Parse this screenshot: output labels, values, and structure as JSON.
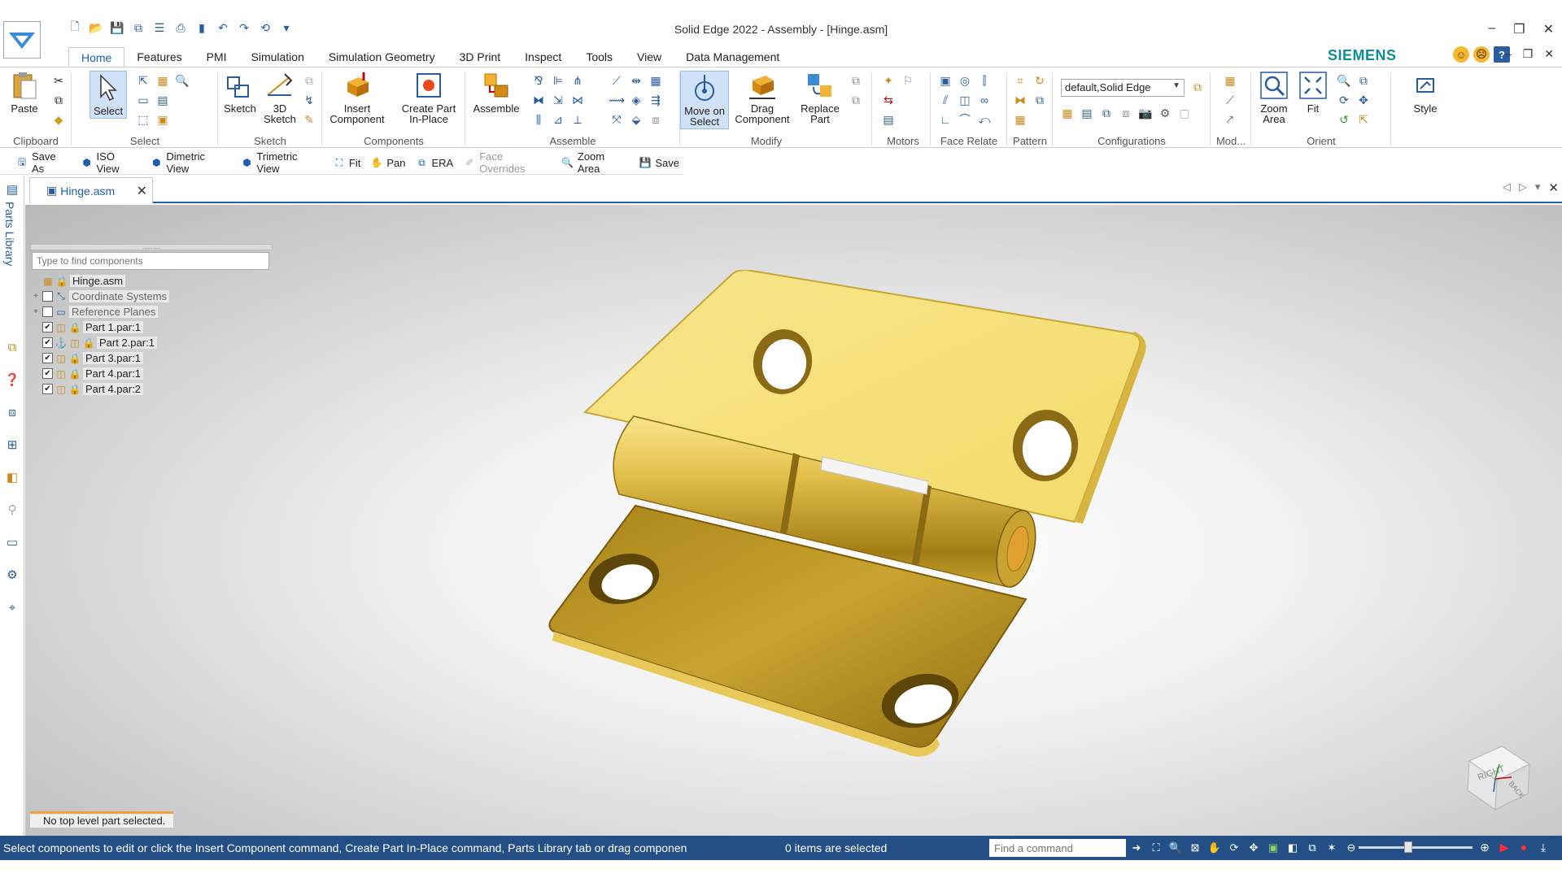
{
  "window": {
    "title": "Solid Edge 2022 - Assembly - [Hinge.asm]",
    "brand": "SIEMENS",
    "brand_color": "#0f8c9a"
  },
  "ribbon_tabs": [
    "Home",
    "Features",
    "PMI",
    "Simulation",
    "Simulation Geometry",
    "3D Print",
    "Inspect",
    "Tools",
    "View",
    "Data Management"
  ],
  "ribbon": {
    "groups": {
      "clipboard": "Clipboard",
      "select": "Select",
      "sketch": "Sketch",
      "components": "Components",
      "assemble": "Assemble",
      "modify": "Modify",
      "motors": "Motors",
      "face_relate": "Face Relate",
      "pattern": "Pattern",
      "configurations": "Configurations",
      "mod": "Mod...",
      "orient": "Orient"
    },
    "buttons": {
      "paste": "Paste",
      "select": "Select",
      "sketch": "Sketch",
      "sketch3d": "3D Sketch",
      "insert_component": "Insert Component",
      "create_part_inplace": "Create Part In-Place",
      "assemble": "Assemble",
      "move_on_select": "Move on Select",
      "drag_component": "Drag Component",
      "replace_part": "Replace Part",
      "zoom_area": "Zoom Area",
      "fit": "Fit",
      "style": "Style"
    },
    "configuration_value": "default,Solid Edge"
  },
  "command_bar": [
    {
      "label": "Save As",
      "icon": "save-as-icon",
      "enabled": true
    },
    {
      "label": "ISO View",
      "icon": "iso-view-icon",
      "enabled": true
    },
    {
      "label": "Dimetric View",
      "icon": "dimetric-view-icon",
      "enabled": true
    },
    {
      "label": "Trimetric View",
      "icon": "trimetric-view-icon",
      "enabled": true
    },
    {
      "label": "Fit",
      "icon": "fit-icon",
      "enabled": true
    },
    {
      "label": "Pan",
      "icon": "pan-icon",
      "enabled": true
    },
    {
      "label": "ERA",
      "icon": "era-icon",
      "enabled": true
    },
    {
      "label": "Face Overrides",
      "icon": "face-overrides-icon",
      "enabled": false
    },
    {
      "label": "Zoom Area",
      "icon": "zoom-area-icon",
      "enabled": true
    },
    {
      "label": "Save",
      "icon": "save-icon",
      "enabled": true
    }
  ],
  "doc_tab": {
    "label": "Hinge.asm"
  },
  "left_strip": {
    "label": "Parts Library"
  },
  "pathfinder": {
    "search_placeholder": "Type to find components",
    "handle": "..........",
    "items": [
      {
        "label": "Hinge.asm",
        "checked": null,
        "expander": ""
      },
      {
        "label": "Coordinate Systems",
        "checked": false,
        "expander": "+"
      },
      {
        "label": "Reference Planes",
        "checked": false,
        "expander": "+"
      },
      {
        "label": "Part 1.par:1",
        "checked": true,
        "expander": ""
      },
      {
        "label": "Part 2.par:1",
        "checked": true,
        "expander": ""
      },
      {
        "label": "Part 3.par:1",
        "checked": true,
        "expander": ""
      },
      {
        "label": "Part 4.par:1",
        "checked": true,
        "expander": ""
      },
      {
        "label": "Part 4.par:2",
        "checked": true,
        "expander": ""
      }
    ]
  },
  "viewport": {
    "status": "No top level part selected.",
    "viewcube_labels": [
      "RIGHT",
      "BACK"
    ]
  },
  "statusbar": {
    "message": "Select components to edit or click the Insert Component command, Create Part In-Place command, Parts Library tab or drag componen",
    "count": "0 items are selected",
    "find_placeholder": "Find a command"
  },
  "colors": {
    "accent": "#1e5fae",
    "statusbar": "#234f86",
    "hinge_gold": "#e8c84a"
  }
}
